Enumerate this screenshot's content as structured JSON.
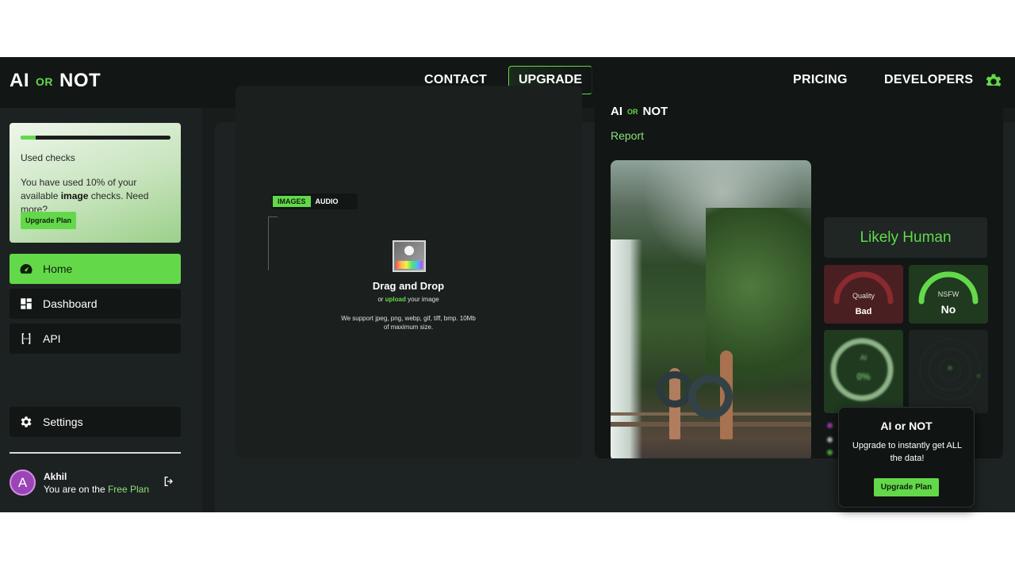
{
  "brand": {
    "left": "AI",
    "mid": "OR",
    "right": "NOT"
  },
  "nav": {
    "contact": "CONTACT",
    "upgrade": "UPGRADE",
    "pricing": "PRICING",
    "developers": "DEVELOPERS"
  },
  "usage": {
    "progress_fraction": 0.1,
    "title": "Used checks",
    "text_before": "You have used 10% of your available ",
    "text_bold": "image",
    "text_after": " checks. Need more?",
    "button": "Upgrade Plan"
  },
  "sidebar": {
    "items": [
      {
        "label": "Home",
        "icon": "gauge-icon",
        "active": true
      },
      {
        "label": "Dashboard",
        "icon": "dashboard-icon",
        "active": false
      },
      {
        "label": "API",
        "icon": "api-icon",
        "active": false
      }
    ],
    "settings": "Settings"
  },
  "user": {
    "initial": "A",
    "name": "Akhil",
    "plan_prefix": "You are on the ",
    "plan_name": "Free Plan"
  },
  "upload": {
    "tabs": [
      "IMAGES",
      "AUDIO"
    ],
    "title": "Drag and Drop",
    "sub_prefix": "or ",
    "sub_link": "upload",
    "sub_suffix": " your image",
    "note": "We support jpeg, png, webp, gif, tiff, bmp. 10Mb of maximum size."
  },
  "report": {
    "title": "Report",
    "verdict": "Likely Human",
    "quality_label": "Quality",
    "quality_value": "Bad",
    "nsfw_label": "NSFW",
    "nsfw_value": "No",
    "ai_label": "AI",
    "ai_value": "0%"
  },
  "upsell": {
    "title": "AI or NOT",
    "text": "Upgrade to instantly get ALL the data!",
    "button": "Upgrade Plan"
  },
  "colors": {
    "accent": "#63d94a",
    "bad": "#8a2a2e",
    "background": "#181d1c"
  }
}
